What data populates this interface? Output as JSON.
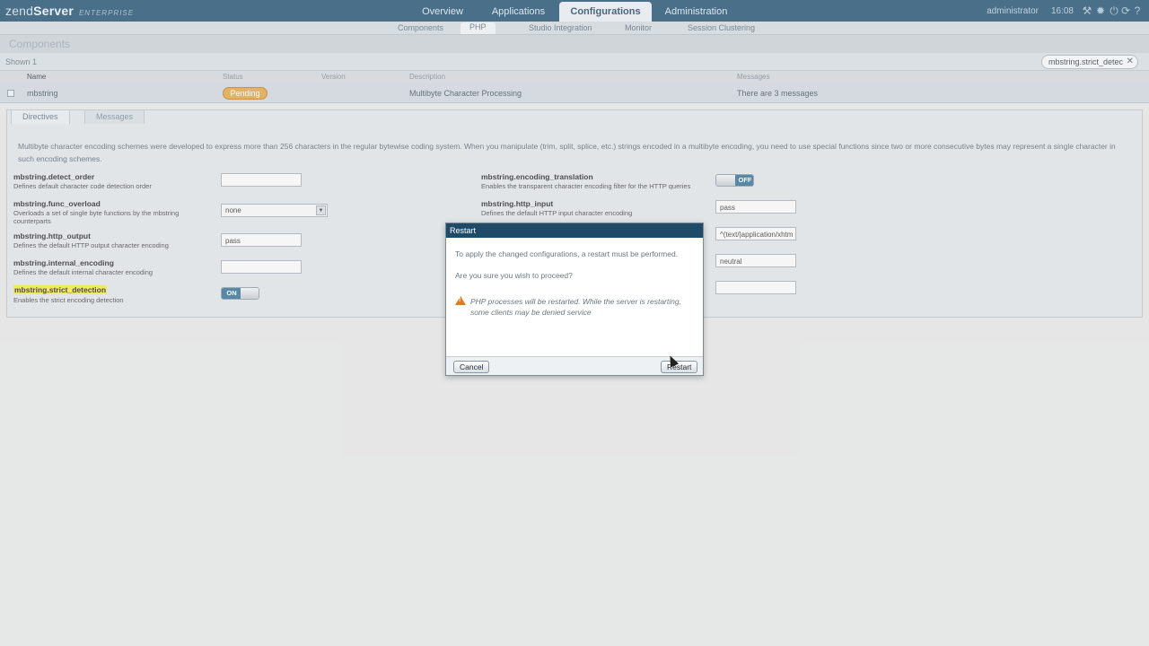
{
  "header": {
    "logo_prefix": "zend",
    "logo_product": "Server",
    "logo_edition": "ENTERPRISE",
    "tabs": [
      {
        "label": "Overview"
      },
      {
        "label": "Applications"
      },
      {
        "label": "Configurations"
      },
      {
        "label": "Administration"
      }
    ],
    "user": "administrator",
    "time": "16:08",
    "icons": [
      "wrench-icon",
      "settings-icon",
      "power-icon",
      "refresh-icon",
      "help-icon"
    ]
  },
  "subnav": {
    "tabs": [
      {
        "label": "Components"
      },
      {
        "label": "PHP"
      },
      {
        "label": "Studio Integration"
      },
      {
        "label": "Monitor"
      },
      {
        "label": "Session Clustering"
      }
    ]
  },
  "page": {
    "title": "Components",
    "shown_text": "Shown 1",
    "filter_chip": "mbstring.strict_detec"
  },
  "table": {
    "headers": {
      "name": "Name",
      "status": "Status",
      "version": "Version",
      "description": "Description",
      "messages": "Messages"
    },
    "row": {
      "name": "mbstring",
      "status": "Pending",
      "version": "",
      "description": "Multibyte Character Processing",
      "messages": "There are 3 messages"
    }
  },
  "panel": {
    "tabs": [
      {
        "label": "Directives"
      },
      {
        "label": "Messages"
      }
    ],
    "description": "Multibyte character encoding schemes were developed to express more than 256 characters in the regular bytewise coding system. When you manipulate (trim, split, splice, etc.) strings encoded in a multibyte encoding, you need to use special functions since two or more consecutive bytes may represent a single character in such encoding schemes.",
    "left_directives": [
      {
        "name": "mbstring.detect_order",
        "help": "Defines default character code detection order",
        "value": ""
      },
      {
        "name": "mbstring.func_overload",
        "help": "Overloads a set of single byte functions by the mbstring counterparts",
        "value": "none"
      },
      {
        "name": "mbstring.http_output",
        "help": "Defines the default HTTP output character encoding",
        "value": "pass"
      },
      {
        "name": "mbstring.internal_encoding",
        "help": "Defines the default internal character encoding",
        "value": ""
      },
      {
        "name": "mbstring.strict_detection",
        "help": "Enables the strict encoding detection",
        "value": "ON"
      }
    ],
    "right_directives": [
      {
        "name": "mbstring.encoding_translation",
        "help": "Enables the transparent character encoding filter for the HTTP queries",
        "value": "OFF"
      },
      {
        "name": "mbstring.http_input",
        "help": "Defines the default HTTP input character encoding",
        "value": "pass"
      },
      {
        "value": "^(text/|application/xhtm"
      },
      {
        "value": "neutral"
      },
      {
        "value": ""
      }
    ]
  },
  "dialog": {
    "title": "Restart",
    "line1": "To apply the changed configurations, a restart must be performed.",
    "line2": "Are you sure you wish to proceed?",
    "warning": "PHP processes will be restarted. While the server is restarting, some clients may be denied service",
    "cancel_label": "Cancel",
    "restart_label": "Restart"
  },
  "colors": {
    "header_bg": "#1d4e6e",
    "pending": "#e1a540",
    "toggle_on": "#2f6d93",
    "toggle_off": "#2f6d93",
    "highlight": "#f4e93a",
    "warning": "#e07b1a"
  }
}
